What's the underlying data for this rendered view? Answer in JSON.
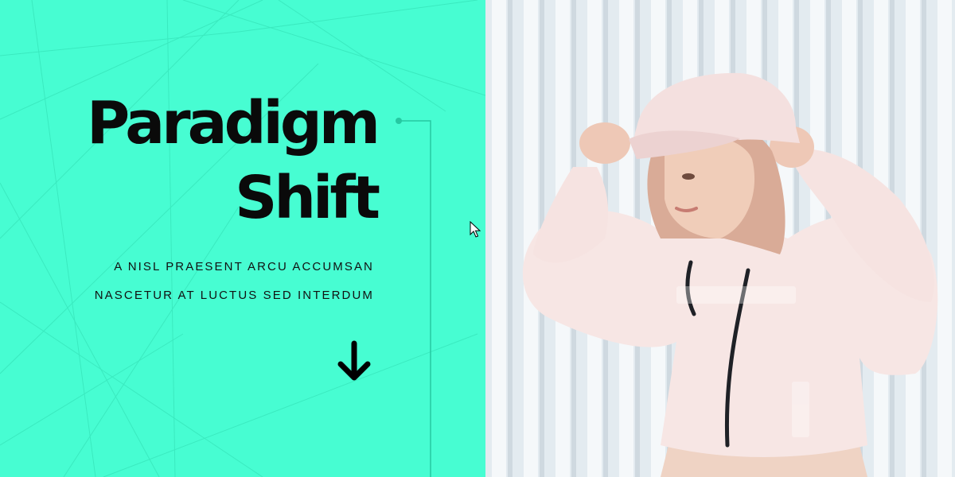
{
  "hero": {
    "title_line1": "Paradigm",
    "title_line2": "Shift",
    "subtitle_line1": "A NISL PRAESENT ARCU ACCUMSAN",
    "subtitle_line2": "NASCETUR AT LUCTUS SED INTERDUM",
    "scroll_icon": "arrow-down-icon"
  },
  "colors": {
    "accent": "#47fdd2",
    "text": "#0a0a0a"
  }
}
